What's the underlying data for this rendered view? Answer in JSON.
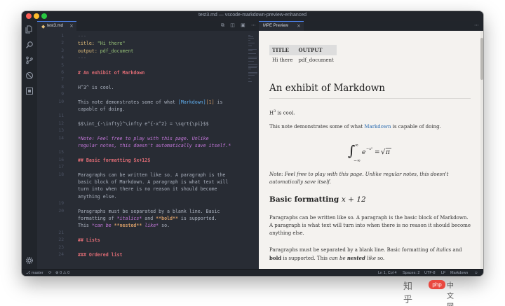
{
  "window": {
    "title": "test3.md — vscode-markdown-preview-enhanced"
  },
  "activity_icons": [
    "files-icon",
    "search-icon",
    "source-control-icon",
    "debug-icon",
    "extensions-icon",
    "settings-gear-icon"
  ],
  "editor": {
    "tab_label": "test3.md",
    "lines": [
      {
        "n": "1",
        "segs": [
          {
            "t": "---",
            "c": "c-gray"
          }
        ]
      },
      {
        "n": "2",
        "segs": [
          {
            "t": "title: ",
            "c": "c-yaml-k"
          },
          {
            "t": "\"Hi there\"",
            "c": "c-yaml-v"
          }
        ]
      },
      {
        "n": "3",
        "segs": [
          {
            "t": "output: ",
            "c": "c-yaml-k"
          },
          {
            "t": "pdf_document",
            "c": "c-yaml-v"
          }
        ]
      },
      {
        "n": "4",
        "segs": [
          {
            "t": "---",
            "c": "c-gray"
          }
        ]
      },
      {
        "n": "5",
        "segs": []
      },
      {
        "n": "6",
        "segs": [
          {
            "t": "# An exhibit of Markdown",
            "c": "c-head"
          }
        ]
      },
      {
        "n": "7",
        "segs": []
      },
      {
        "n": "8",
        "segs": [
          {
            "t": "H^3^ is cool.",
            "c": ""
          }
        ]
      },
      {
        "n": "9",
        "segs": []
      },
      {
        "n": "10",
        "segs": [
          {
            "t": "This note demonstrates some of what ",
            "c": ""
          },
          {
            "t": "[Markdown]",
            "c": "c-link"
          },
          {
            "t": "[1]",
            "c": "c-num"
          },
          {
            "t": " is",
            "c": ""
          }
        ]
      },
      {
        "n": "",
        "segs": [
          {
            "t": "capable of doing.",
            "c": ""
          }
        ]
      },
      {
        "n": "11",
        "segs": []
      },
      {
        "n": "12",
        "segs": [
          {
            "t": "$$\\int_{-\\infty}^\\infty e^{-x^2} = \\sqrt{\\pi}$$",
            "c": ""
          }
        ]
      },
      {
        "n": "13",
        "segs": []
      },
      {
        "n": "14",
        "segs": [
          {
            "t": "*Note: Feel free to play with this page. Unlike",
            "c": "c-italic"
          }
        ]
      },
      {
        "n": "",
        "segs": [
          {
            "t": "regular notes, this doesn't automatically save itself.*",
            "c": "c-italic"
          }
        ]
      },
      {
        "n": "15",
        "segs": []
      },
      {
        "n": "16",
        "segs": [
          {
            "t": "## Basic formatting $x+12$",
            "c": "c-head"
          }
        ]
      },
      {
        "n": "17",
        "segs": []
      },
      {
        "n": "18",
        "segs": [
          {
            "t": "Paragraphs can be written like so. A paragraph is the",
            "c": ""
          }
        ]
      },
      {
        "n": "",
        "segs": [
          {
            "t": "basic block of Markdown. A paragraph is what text will",
            "c": ""
          }
        ]
      },
      {
        "n": "",
        "segs": [
          {
            "t": "turn into when there is no reason it should become",
            "c": ""
          }
        ]
      },
      {
        "n": "",
        "segs": [
          {
            "t": "anything else.",
            "c": ""
          }
        ]
      },
      {
        "n": "19",
        "segs": []
      },
      {
        "n": "20",
        "segs": [
          {
            "t": "Paragraphs must be separated by a blank line. Basic",
            "c": ""
          }
        ]
      },
      {
        "n": "",
        "segs": [
          {
            "t": "formatting of ",
            "c": ""
          },
          {
            "t": "*italics*",
            "c": "c-italic"
          },
          {
            "t": " and ",
            "c": ""
          },
          {
            "t": "**bold**",
            "c": "c-bold"
          },
          {
            "t": " is supported.",
            "c": ""
          }
        ]
      },
      {
        "n": "",
        "segs": [
          {
            "t": "This ",
            "c": ""
          },
          {
            "t": "*can be ",
            "c": "c-italic"
          },
          {
            "t": "**nested**",
            "c": "c-bold"
          },
          {
            "t": " like*",
            "c": "c-italic"
          },
          {
            "t": " so.",
            "c": ""
          }
        ]
      },
      {
        "n": "21",
        "segs": []
      },
      {
        "n": "22",
        "segs": [
          {
            "t": "## Lists",
            "c": "c-head"
          }
        ]
      },
      {
        "n": "23",
        "segs": []
      },
      {
        "n": "24",
        "segs": [
          {
            "t": "### Ordered list",
            "c": "c-head"
          }
        ]
      }
    ]
  },
  "preview": {
    "tab_label": "MPE Preview",
    "table": {
      "headers": [
        "TITLE",
        "OUTPUT"
      ],
      "row": [
        "Hi there",
        "pdf_document"
      ]
    },
    "h1": "An exhibit of Markdown",
    "cool_text": "H",
    "cool_sup": "3",
    "cool_rest": " is cool.",
    "demo_before": "This note demonstrates some of what ",
    "demo_link": "Markdown",
    "demo_after": " is capable of doing.",
    "note": "Note: Feel free to play with this page. Unlike regular notes, this doesn't automatically save itself.",
    "h2_text": "Basic formatting ",
    "h2_math": "x + 12",
    "para1": "Paragraphs can be written like so. A paragraph is the basic block of Markdown. A paragraph is what text will turn into when there is no reason it should become anything else.",
    "para2_a": "Paragraphs must be separated by a blank line. Basic formatting of ",
    "para2_italic": "italics",
    "para2_b": " and ",
    "para2_bold": "bold",
    "para2_c": " is supported. This ",
    "para2_can": "can be ",
    "para2_nested": "nested",
    "para2_like": " like",
    "para2_d": " so."
  },
  "statusbar": {
    "branch": "master",
    "sync": "⟳",
    "problems": "⊗ 0 ⚠ 0",
    "position": "Ln 1, Col 4",
    "spaces": "Spaces: 2",
    "encoding": "UTF-8",
    "eol": "LF",
    "language": "Markdown",
    "feedback_icon": "☺"
  },
  "watermark": {
    "zhihu": "知乎",
    "php": "php",
    "cn": "中文网"
  },
  "colors": {
    "accent": "#528bff",
    "preview_bg": "#f4f2ef",
    "editor_bg": "#282c34"
  }
}
